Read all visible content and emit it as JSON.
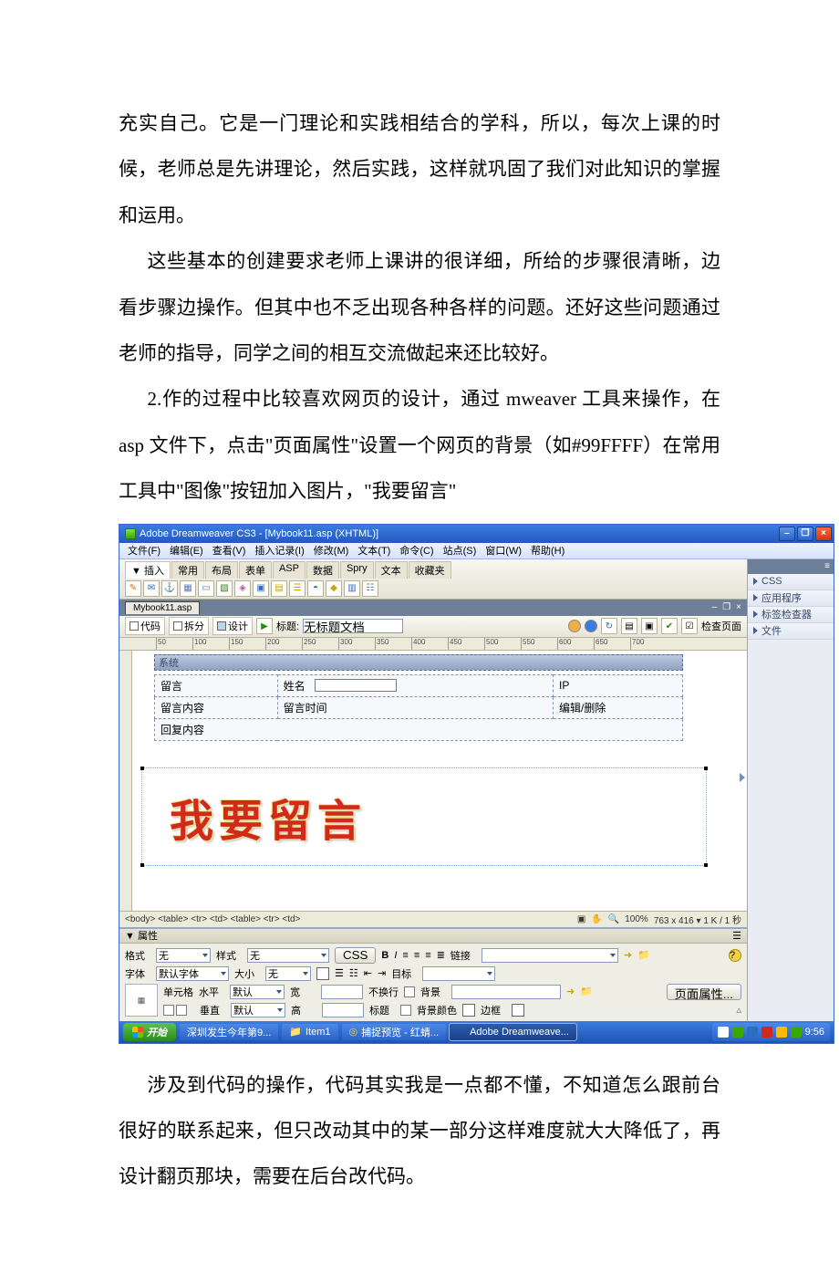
{
  "doc": {
    "p1": "充实自己。它是一门理论和实践相结合的学科，所以，每次上课的时候，老师总是先讲理论，然后实践，这样就巩固了我们对此知识的掌握和运用。",
    "p2": "这些基本的创建要求老师上课讲的很详细，所给的步骤很清晰，边看步骤边操作。但其中也不乏出现各种各样的问题。还好这些问题通过老师的指导，同学之间的相互交流做起来还比较好。",
    "p3": "2.作的过程中比较喜欢网页的设计，通过 mweaver 工具来操作，在 asp 文件下，点击\"页面属性\"设置一个网页的背景（如#99FFFF）在常用工具中\"图像\"按钮加入图片，\"我要留言\"",
    "p4": "涉及到代码的操作，代码其实我是一点都不懂，不知道怎么跟前台很好的联系起来，但只改动其中的某一部分这样难度就大大降低了，再设计翻页那块，需要在后台改代码。"
  },
  "app": {
    "title": "Adobe Dreamweaver CS3 - [Mybook11.asp (XHTML)]",
    "menus": [
      "文件(F)",
      "编辑(E)",
      "查看(V)",
      "插入记录(I)",
      "修改(M)",
      "文本(T)",
      "命令(C)",
      "站点(S)",
      "窗口(W)",
      "帮助(H)"
    ],
    "insert": {
      "label": "▼ 插入",
      "tabs": [
        "常用",
        "布局",
        "表单",
        "ASP",
        "数据",
        "Spry",
        "文本",
        "收藏夹"
      ]
    },
    "side_panels": [
      "CSS",
      "应用程序",
      "标签检查器",
      "文件"
    ],
    "doc_tab": "Mybook11.asp",
    "doc_toolbar": {
      "code": "代码",
      "split": "拆分",
      "design": "设计",
      "title_label": "标题:",
      "title_value": "无标题文档",
      "check": "检查页面"
    },
    "ruler_ticks": [
      "50",
      "100",
      "150",
      "200",
      "250",
      "300",
      "350",
      "400",
      "450",
      "500",
      "550",
      "600",
      "650",
      "700"
    ],
    "canvas": {
      "sys_label": "系统",
      "table": {
        "r1": [
          "留言",
          "姓名",
          "IP"
        ],
        "r2_left": "留言内容",
        "r2_mid": "留言时间",
        "r2_right": "编辑/删除",
        "r3": "回复内容"
      },
      "banner_text": "我要留言"
    },
    "status": {
      "breadcrumb": "<body> <table> <tr> <td> <table> <tr> <td>",
      "zoom": "100%",
      "dims": "763 x 416 ▾ 1 K / 1 秒"
    },
    "props": {
      "panel_title": "▼ 属性",
      "row1": {
        "format": "格式",
        "format_v": "无",
        "style": "样式",
        "style_v": "无",
        "css_btn": "CSS",
        "bold": "B",
        "italic": "I",
        "link": "链接"
      },
      "row2": {
        "font": "字体",
        "font_v": "默认字体",
        "size": "大小",
        "size_v": "无",
        "target": "目标"
      },
      "row3": {
        "cell": "单元格",
        "horiz": "水平",
        "horiz_v": "默认",
        "width": "宽",
        "nowrap": "不换行",
        "bg": "背景",
        "pageprops": "页面属性..."
      },
      "row4": {
        "vert": "垂直",
        "vert_v": "默认",
        "height": "高",
        "header": "标题",
        "bgcolor": "背景颜色",
        "border": "边框"
      }
    },
    "taskbar": {
      "start": "开始",
      "items": [
        "深圳发生今年第9...",
        "Item1",
        "捕捉预览 - 红蜻...",
        "Adobe Dreamweave..."
      ],
      "time": "9:56"
    }
  }
}
